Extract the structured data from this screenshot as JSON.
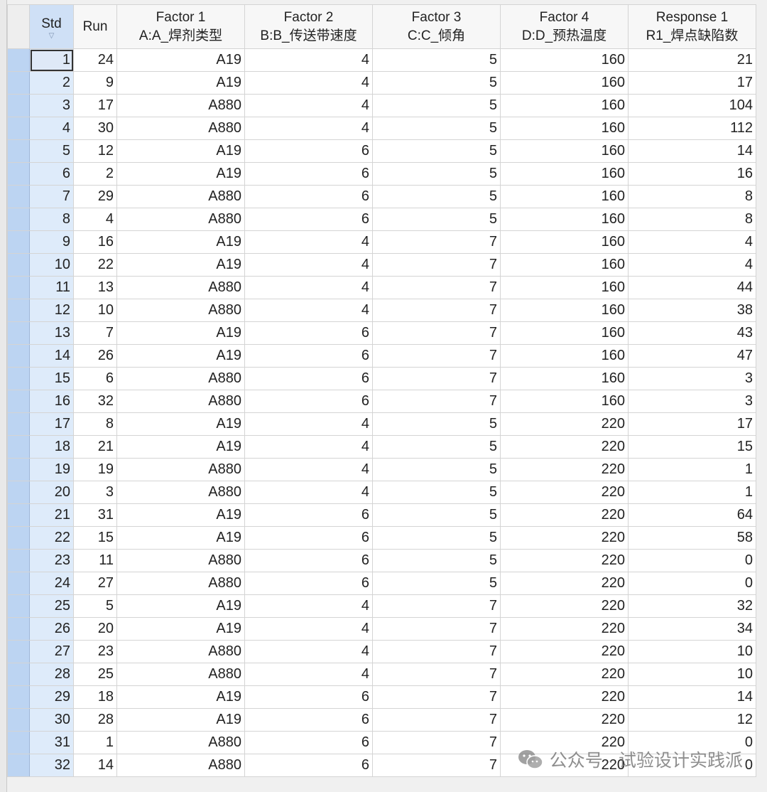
{
  "headers": {
    "std": "Std",
    "run": "Run",
    "f1": [
      "Factor 1",
      "A:A_焊剂类型"
    ],
    "f2": [
      "Factor 2",
      "B:B_传送带速度"
    ],
    "f3": [
      "Factor 3",
      "C:C_倾角"
    ],
    "f4": [
      "Factor 4",
      "D:D_预热温度"
    ],
    "r1": [
      "Response 1",
      "R1_焊点缺陷数"
    ]
  },
  "rows": [
    [
      "1",
      "24",
      "A19",
      "4",
      "5",
      "160",
      "21"
    ],
    [
      "2",
      "9",
      "A19",
      "4",
      "5",
      "160",
      "17"
    ],
    [
      "3",
      "17",
      "A880",
      "4",
      "5",
      "160",
      "104"
    ],
    [
      "4",
      "30",
      "A880",
      "4",
      "5",
      "160",
      "112"
    ],
    [
      "5",
      "12",
      "A19",
      "6",
      "5",
      "160",
      "14"
    ],
    [
      "6",
      "2",
      "A19",
      "6",
      "5",
      "160",
      "16"
    ],
    [
      "7",
      "29",
      "A880",
      "6",
      "5",
      "160",
      "8"
    ],
    [
      "8",
      "4",
      "A880",
      "6",
      "5",
      "160",
      "8"
    ],
    [
      "9",
      "16",
      "A19",
      "4",
      "7",
      "160",
      "4"
    ],
    [
      "10",
      "22",
      "A19",
      "4",
      "7",
      "160",
      "4"
    ],
    [
      "11",
      "13",
      "A880",
      "4",
      "7",
      "160",
      "44"
    ],
    [
      "12",
      "10",
      "A880",
      "4",
      "7",
      "160",
      "38"
    ],
    [
      "13",
      "7",
      "A19",
      "6",
      "7",
      "160",
      "43"
    ],
    [
      "14",
      "26",
      "A19",
      "6",
      "7",
      "160",
      "47"
    ],
    [
      "15",
      "6",
      "A880",
      "6",
      "7",
      "160",
      "3"
    ],
    [
      "16",
      "32",
      "A880",
      "6",
      "7",
      "160",
      "3"
    ],
    [
      "17",
      "8",
      "A19",
      "4",
      "5",
      "220",
      "17"
    ],
    [
      "18",
      "21",
      "A19",
      "4",
      "5",
      "220",
      "15"
    ],
    [
      "19",
      "19",
      "A880",
      "4",
      "5",
      "220",
      "1"
    ],
    [
      "20",
      "3",
      "A880",
      "4",
      "5",
      "220",
      "1"
    ],
    [
      "21",
      "31",
      "A19",
      "6",
      "5",
      "220",
      "64"
    ],
    [
      "22",
      "15",
      "A19",
      "6",
      "5",
      "220",
      "58"
    ],
    [
      "23",
      "11",
      "A880",
      "6",
      "5",
      "220",
      "0"
    ],
    [
      "24",
      "27",
      "A880",
      "6",
      "5",
      "220",
      "0"
    ],
    [
      "25",
      "5",
      "A19",
      "4",
      "7",
      "220",
      "32"
    ],
    [
      "26",
      "20",
      "A19",
      "4",
      "7",
      "220",
      "34"
    ],
    [
      "27",
      "23",
      "A880",
      "4",
      "7",
      "220",
      "10"
    ],
    [
      "28",
      "25",
      "A880",
      "4",
      "7",
      "220",
      "10"
    ],
    [
      "29",
      "18",
      "A19",
      "6",
      "7",
      "220",
      "14"
    ],
    [
      "30",
      "28",
      "A19",
      "6",
      "7",
      "220",
      "12"
    ],
    [
      "31",
      "1",
      "A880",
      "6",
      "7",
      "220",
      "0"
    ],
    [
      "32",
      "14",
      "A880",
      "6",
      "7",
      "220",
      "0"
    ]
  ],
  "watermark": "公众号 · 试验设计实践派",
  "icons": {
    "sort": "sort-down-icon",
    "watermark": "wechat-icon"
  },
  "colors": {
    "selector": "#bcd4f2",
    "std_header": "#cfe0f6",
    "grid_line": "#d4d4d4"
  }
}
